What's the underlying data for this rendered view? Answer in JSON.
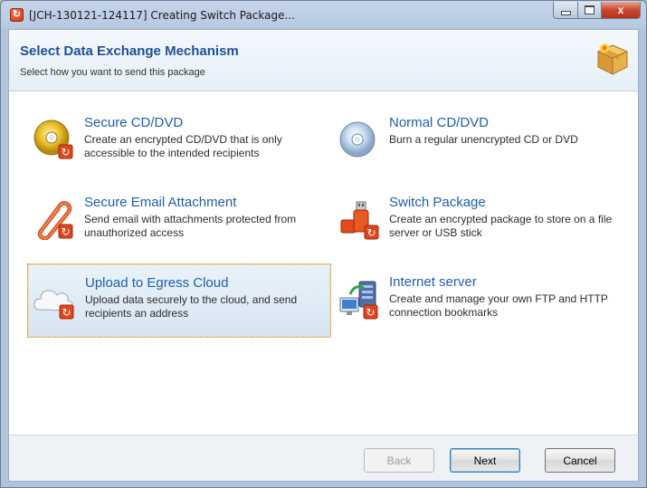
{
  "window": {
    "title": "[JCH-130121-124117] Creating Switch Package...",
    "close_glyph": "x"
  },
  "header": {
    "title": "Select Data Exchange Mechanism",
    "subtitle": "Select how you want to send this package",
    "icon": "package-box-icon"
  },
  "options": [
    {
      "title": "Secure CD/DVD",
      "description": "Create an encrypted CD/DVD that is only accessible to the intended recipients",
      "icon": "secure-cd-icon",
      "selected": false
    },
    {
      "title": "Normal CD/DVD",
      "description": "Burn a regular unencrypted CD or DVD",
      "icon": "cd-icon",
      "selected": false
    },
    {
      "title": "Secure Email Attachment",
      "description": "Send email with attachments protected from unauthorized access",
      "icon": "paperclip-icon",
      "selected": false
    },
    {
      "title": "Switch Package",
      "description": "Create an encrypted package to store on a file server or USB stick",
      "icon": "usb-stick-icon",
      "selected": false
    },
    {
      "title": "Upload to Egress Cloud",
      "description": "Upload data securely to the cloud, and send recipients an address",
      "icon": "cloud-icon",
      "selected": true
    },
    {
      "title": "Internet server",
      "description": "Create and manage your own FTP and HTTP connection bookmarks",
      "icon": "server-icon",
      "selected": false
    }
  ],
  "footer": {
    "back_label": "Back",
    "next_label": "Next",
    "cancel_label": "Cancel"
  },
  "colors": {
    "title_blue": "#1f4f9a",
    "option_blue": "#1f5fb0",
    "selection_border": "#d18a23",
    "egress_orange": "#e0461c"
  }
}
